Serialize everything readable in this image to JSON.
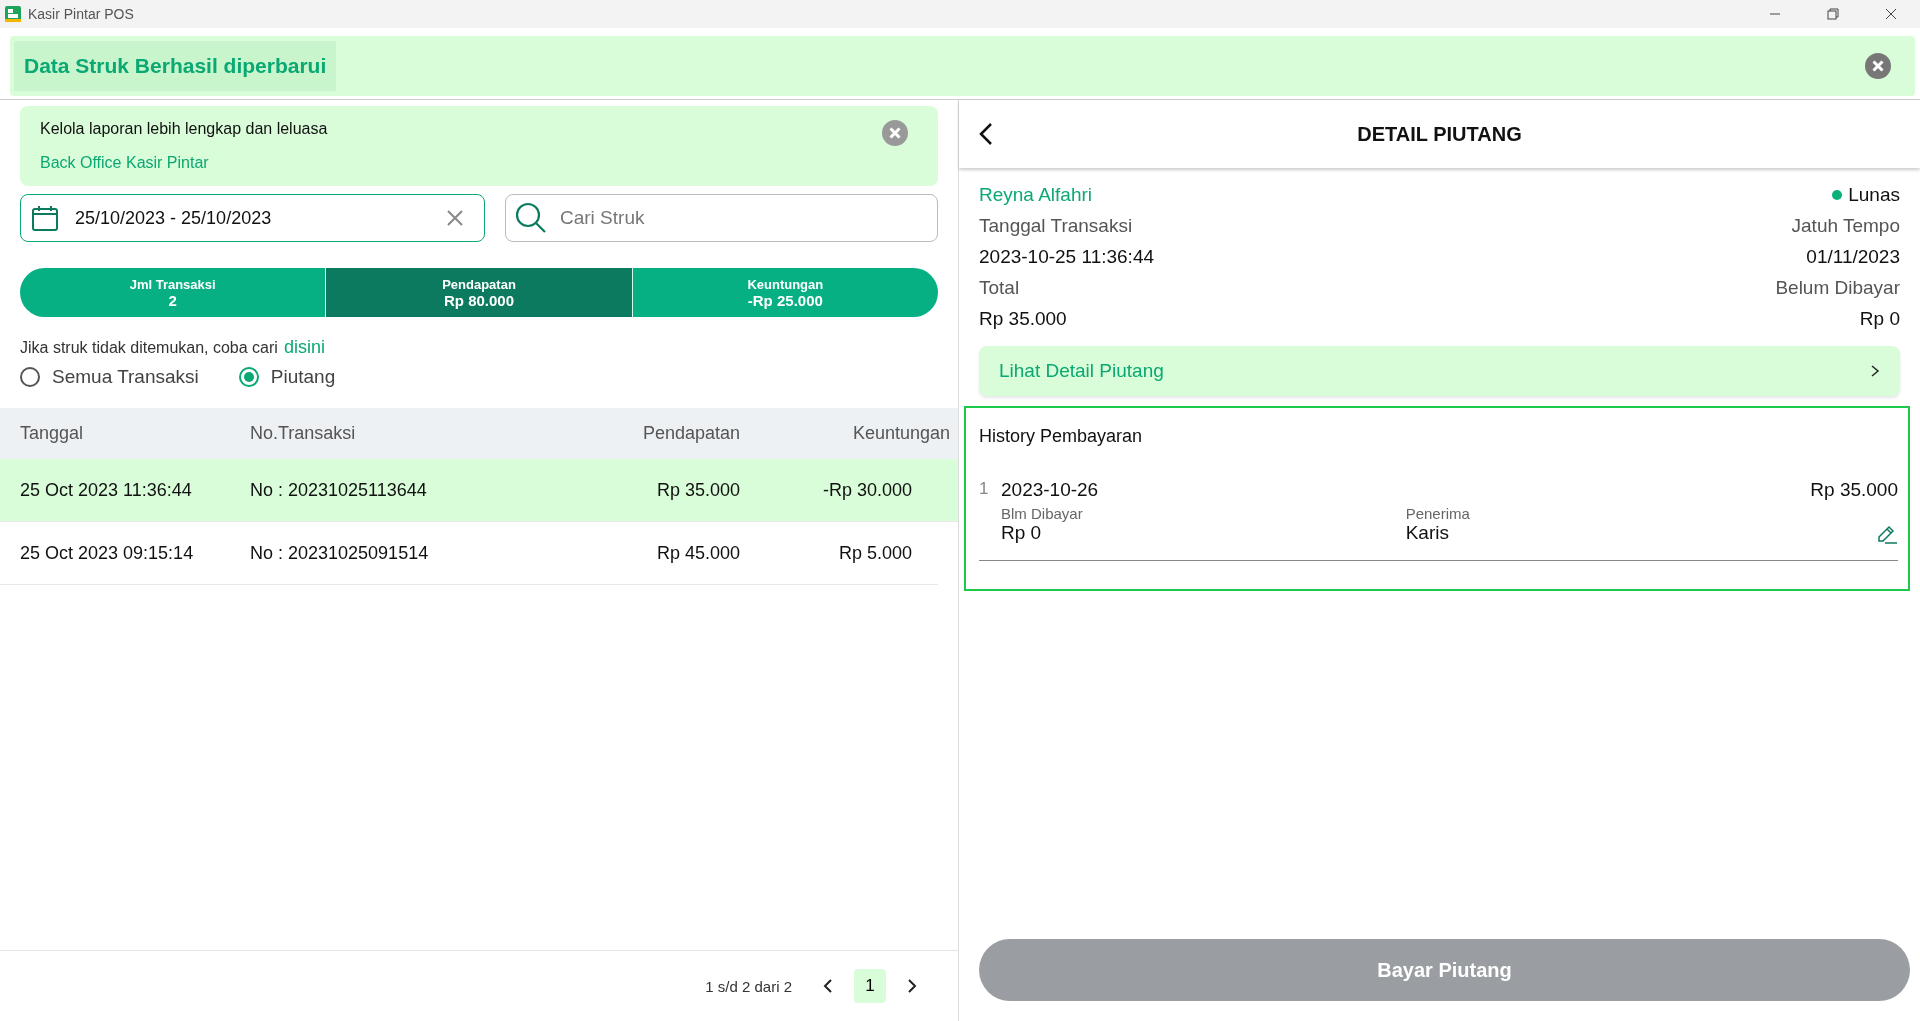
{
  "window": {
    "title": "Kasir Pintar POS"
  },
  "toast": {
    "message": "Data Struk Berhasil diperbarui"
  },
  "banner": {
    "text": "Kelola laporan lebih lengkap dan leluasa",
    "link": "Back Office Kasir Pintar"
  },
  "date_filter": {
    "value": "25/10/2023 - 25/10/2023"
  },
  "search": {
    "placeholder": "Cari Struk"
  },
  "stats": [
    {
      "label": "Jml Transaksi",
      "value": "2",
      "selected": false
    },
    {
      "label": "Pendapatan",
      "value": "Rp 80.000",
      "selected": true
    },
    {
      "label": "Keuntungan",
      "value": "-Rp 25.000",
      "selected": false
    }
  ],
  "hint": {
    "text": "Jika struk tidak ditemukan, coba cari",
    "link": "disini"
  },
  "filters": [
    {
      "label": "Semua Transaksi",
      "selected": false
    },
    {
      "label": "Piutang",
      "selected": true
    }
  ],
  "table": {
    "columns": [
      "Tanggal",
      "No.Transaksi",
      "Pendapatan",
      "Keuntungan"
    ],
    "rows": [
      {
        "cells": [
          "25 Oct 2023 11:36:44",
          "No : 20231025113644",
          "Rp 35.000",
          "-Rp 30.000"
        ],
        "selected": true
      },
      {
        "cells": [
          "25 Oct 2023 09:15:14",
          "No : 20231025091514",
          "Rp 45.000",
          "Rp 5.000"
        ],
        "selected": false
      }
    ]
  },
  "pagination": {
    "summary": "1 s/d 2 dari 2",
    "pages": [
      {
        "label": "1",
        "selected": true
      }
    ]
  },
  "detail": {
    "title": "DETAIL PIUTANG",
    "customer": "Reyna Alfahri",
    "status": {
      "label": "Lunas",
      "color": "#0bb07b"
    },
    "left": [
      {
        "label": "Tanggal Transaksi",
        "value": "2023-10-25 11:36:44"
      },
      {
        "label": "Total",
        "value": "Rp 35.000"
      }
    ],
    "right": [
      {
        "label": "Jatuh Tempo",
        "value": "01/11/2023"
      },
      {
        "label": "Belum Dibayar",
        "value": "Rp 0"
      }
    ],
    "link_button": "Lihat Detail Piutang",
    "history": {
      "title": "History Pembayaran",
      "entries": [
        {
          "number": "1",
          "date": "2023-10-26",
          "amount": "Rp 35.000",
          "unpaid_label": "Blm Dibayar",
          "unpaid_value": "Rp 0",
          "receiver_label": "Penerima",
          "receiver_value": "Karis"
        }
      ]
    },
    "pay_button": {
      "label": "Bayar Piutang",
      "disabled": true
    }
  }
}
